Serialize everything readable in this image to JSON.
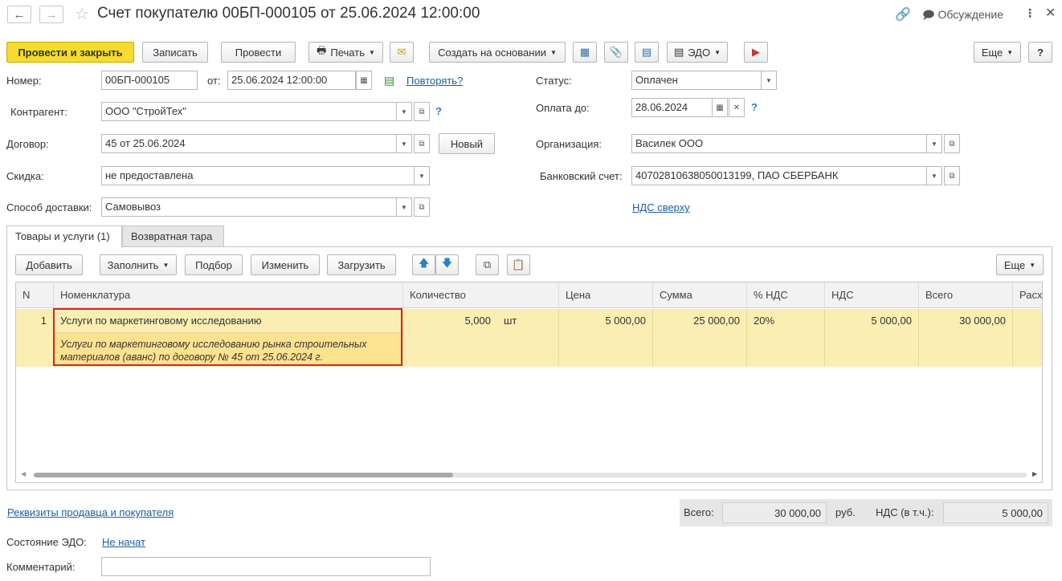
{
  "header": {
    "title": "Счет покупателю 00БП-000105 от 25.06.2024 12:00:00",
    "discussion": "Обсуждение"
  },
  "toolbar": {
    "post_and_close": "Провести и закрыть",
    "save": "Записать",
    "post": "Провести",
    "print": "Печать",
    "create_based_on": "Создать на основании",
    "edo": "ЭДО",
    "more": "Еще",
    "help": "?"
  },
  "form": {
    "number_label": "Номер:",
    "number": "00БП-000105",
    "from_label": "от:",
    "date": "25.06.2024 12:00:00",
    "repeat_link": "Повторять?",
    "status_label": "Статус:",
    "status": "Оплачен",
    "counterparty_label": "Контрагент:",
    "counterparty": "ООО \"СтройТех\"",
    "pay_until_label": "Оплата до:",
    "pay_until": "28.06.2024",
    "contract_label": "Договор:",
    "contract": "45 от 25.06.2024",
    "new_button": "Новый",
    "organization_label": "Организация:",
    "organization": "Василек ООО",
    "discount_label": "Скидка:",
    "discount": "не предоставлена",
    "bank_account_label": "Банковский счет:",
    "bank_account": "40702810638050013199, ПАО СБЕРБАНК",
    "delivery_label": "Способ доставки:",
    "delivery": "Самовывоз",
    "vat_link": "НДС сверху"
  },
  "tabs": [
    {
      "label": "Товары и услуги (1)"
    },
    {
      "label": "Возвратная тара"
    }
  ],
  "table_toolbar": {
    "add": "Добавить",
    "fill": "Заполнить",
    "pick": "Подбор",
    "change": "Изменить",
    "load": "Загрузить",
    "more": "Еще"
  },
  "table": {
    "columns": [
      "N",
      "Номенклатура",
      "Количество",
      "Цена",
      "Сумма",
      "% НДС",
      "НДС",
      "Всего",
      "Расх"
    ],
    "rows": [
      {
        "n": "1",
        "item": "Услуги по маркетинговому исследованию",
        "description": "Услуги по маркетинговому исследованию рынка строительных материалов (аванс) по договору № 45 от 25.06.2024 г.",
        "description_line1": "Услуги по маркетинговому исследованию рынка строительных",
        "description_line2": "материалов (аванс) по договору № 45 от 25.06.2024 г.",
        "quantity": "5,000",
        "unit": "шт",
        "price": "5 000,00",
        "sum": "25 000,00",
        "vat_rate": "20%",
        "vat": "5 000,00",
        "total": "30 000,00"
      }
    ]
  },
  "footer": {
    "requisites_link": "Реквизиты продавца и покупателя",
    "total_label": "Всего:",
    "total": "30 000,00",
    "currency": "руб.",
    "vat_label": "НДС (в т.ч.):",
    "vat": "5 000,00",
    "edo_state_label": "Состояние ЭДО:",
    "edo_state": "Не начат",
    "comment_label": "Комментарий:",
    "comment": ""
  }
}
